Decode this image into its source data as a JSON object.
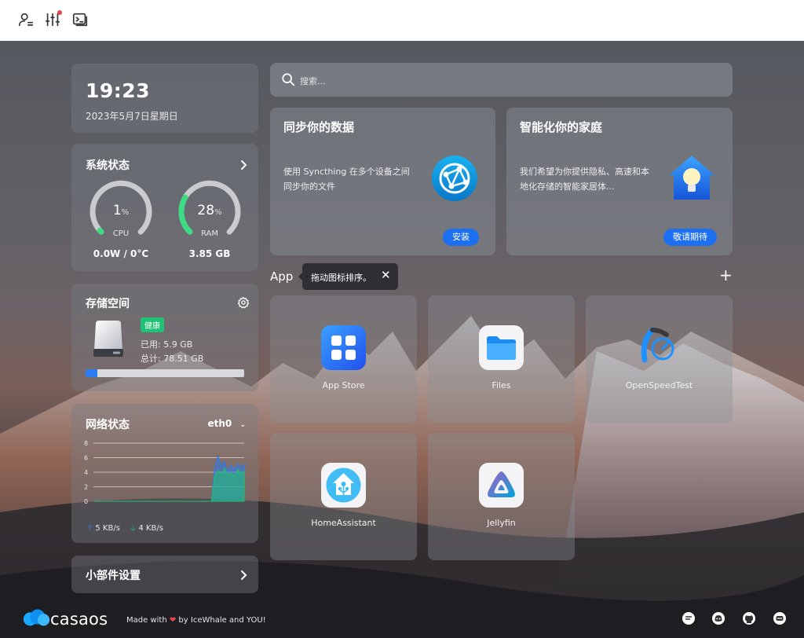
{
  "topbar": {
    "icons": [
      "user-settings-icon",
      "sliders-icon",
      "terminal-icon"
    ],
    "notification_color": "#e5484d"
  },
  "clock": {
    "time": "19:23",
    "date": "2023年5月7日星期日"
  },
  "system_status": {
    "title": "系统状态",
    "cpu": {
      "value": "1",
      "unit": "%",
      "label": "CPU",
      "sub": "0.0W / 0°C",
      "percent": 1,
      "color": "#3ddc84"
    },
    "ram": {
      "value": "28",
      "unit": "%",
      "label": "RAM",
      "sub": "3.85 GB",
      "percent": 28,
      "color": "#3ddc84"
    }
  },
  "storage": {
    "title": "存储空间",
    "status": "健康",
    "used": "已用: 5.9 GB",
    "total": "总计: 78.51 GB",
    "used_fraction": 0.075,
    "status_color": "#1ec274"
  },
  "network": {
    "title": "网络状态",
    "interface": "eth0",
    "upload": "5 KB/s",
    "download": "4 KB/s",
    "upload_color": "#2b7cf0",
    "download_color": "#1ec274"
  },
  "chart_data": {
    "type": "area",
    "yticks": [
      "8",
      "6",
      "4",
      "2",
      "0"
    ],
    "ylim": [
      0,
      8
    ],
    "series": [
      {
        "values": [
          0,
          0,
          0,
          0,
          0,
          0,
          0,
          0,
          0,
          0,
          0,
          0,
          0,
          0,
          0,
          0,
          0,
          0,
          0,
          0,
          0,
          0,
          0,
          0,
          0,
          0,
          0,
          0,
          0,
          0,
          0,
          0,
          0,
          0,
          0,
          0,
          0,
          4.5,
          6.2,
          4.8,
          5.5,
          4.1,
          5.0,
          4.3,
          5.2,
          4.6,
          5.1
        ]
      },
      {
        "values": [
          0,
          0,
          0,
          0,
          0,
          0,
          0,
          0,
          0,
          0,
          0,
          0,
          0,
          0,
          0,
          0,
          0,
          0,
          0,
          0,
          0,
          0,
          0,
          0,
          0,
          0,
          0,
          0,
          0,
          0,
          0,
          0,
          0,
          0,
          0,
          0,
          0,
          3.5,
          4.2,
          3.8,
          4.5,
          3.6,
          4.0,
          3.4,
          4.4,
          3.9,
          4.1
        ]
      }
    ]
  },
  "widget_settings": {
    "label": "小部件设置"
  },
  "search": {
    "placeholder": "搜索..."
  },
  "promos": [
    {
      "title": "同步你的数据",
      "desc": "使用 Syncthing 在多个设备之间同步你的文件",
      "button": "安装"
    },
    {
      "title": "智能化你的家庭",
      "desc": "我们希望为你提供隐私、高速和本地化存储的智能家居体...",
      "button": "敬请期待"
    }
  ],
  "apps_section": {
    "title": "App",
    "tooltip": "拖动图标排序。",
    "close": "✕",
    "add": "+"
  },
  "apps": [
    {
      "name": "App Store",
      "icon": "app-store-icon"
    },
    {
      "name": "Files",
      "icon": "files-icon"
    },
    {
      "name": "OpenSpeedTest",
      "icon": "openspeedtest-icon"
    },
    {
      "name": "HomeAssistant",
      "icon": "homeassistant-icon"
    },
    {
      "name": "Jellyfin",
      "icon": "jellyfin-icon"
    }
  ],
  "footer": {
    "brand": "casaos",
    "made_prefix": "Made with",
    "made_suffix": "by IceWhale and YOU!",
    "heart_color": "#e5484d",
    "icons": [
      "feedback-icon",
      "discord-icon",
      "github-icon",
      "chat-icon"
    ]
  }
}
